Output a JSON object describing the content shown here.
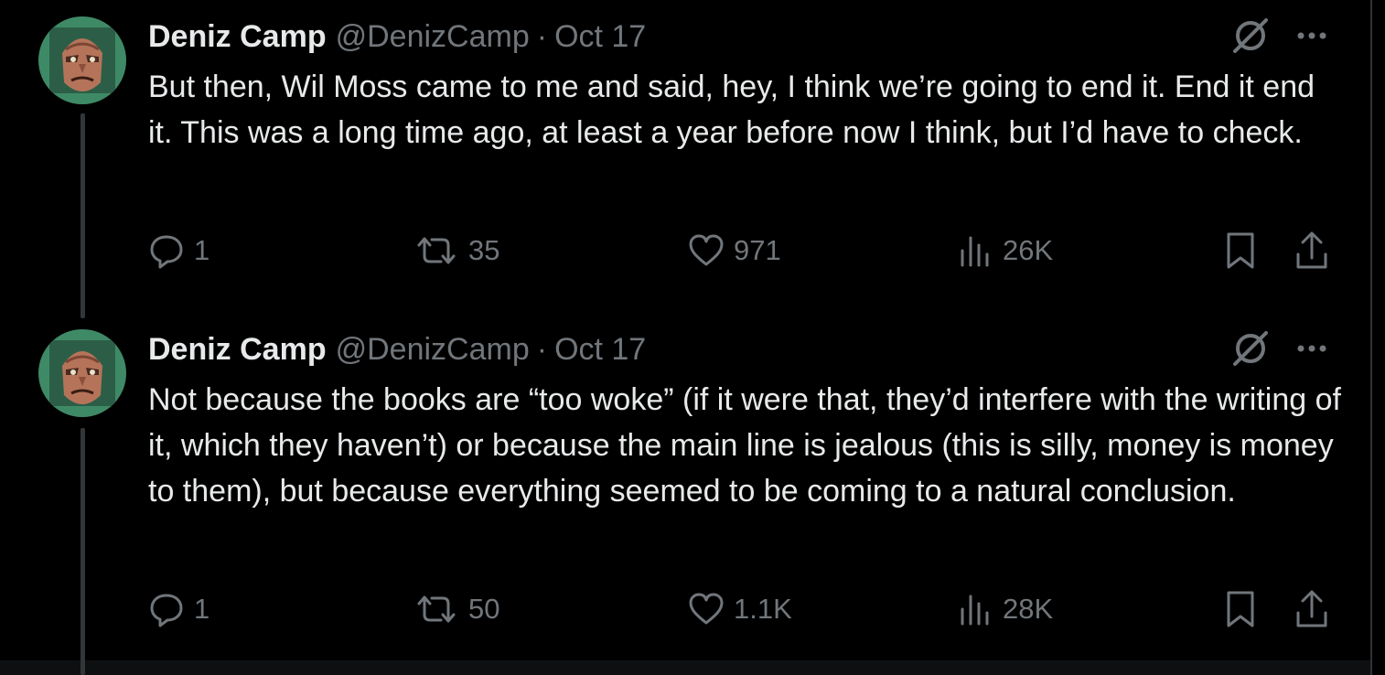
{
  "tweets": [
    {
      "author_name": "Deniz Camp",
      "handle": "@DenizCamp",
      "separator": "·",
      "date": "Oct 17",
      "text": "But then, Wil Moss came to me and said, hey, I think we’re going to end it. End it end it. This was a long time ago, at least a year before now I think, but I’d have to check.",
      "replies": "1",
      "reposts": "35",
      "likes": "971",
      "views": "26K"
    },
    {
      "author_name": "Deniz Camp",
      "handle": "@DenizCamp",
      "separator": "·",
      "date": "Oct 17",
      "text": "Not because the books are “too woke” (if it were that, they’d interfere with the writing of it, which they haven’t) or because the main line is jealous (this is silly, money is money to them), but because everything seemed to be coming to a natural conclusion.",
      "replies": "1",
      "reposts": "50",
      "likes": "1.1K",
      "views": "28K"
    }
  ],
  "icons": {
    "reply": "reply-icon",
    "repost": "repost-icon",
    "like": "heart-icon",
    "views": "views-icon",
    "bookmark": "bookmark-icon",
    "share": "share-icon",
    "grok": "grok-icon",
    "more": "more-icon"
  },
  "colors": {
    "background": "#000000",
    "text_primary": "#e7e9ea",
    "text_secondary": "#71767b",
    "thread_line": "#333639",
    "avatar_green": "#3f8a66"
  }
}
